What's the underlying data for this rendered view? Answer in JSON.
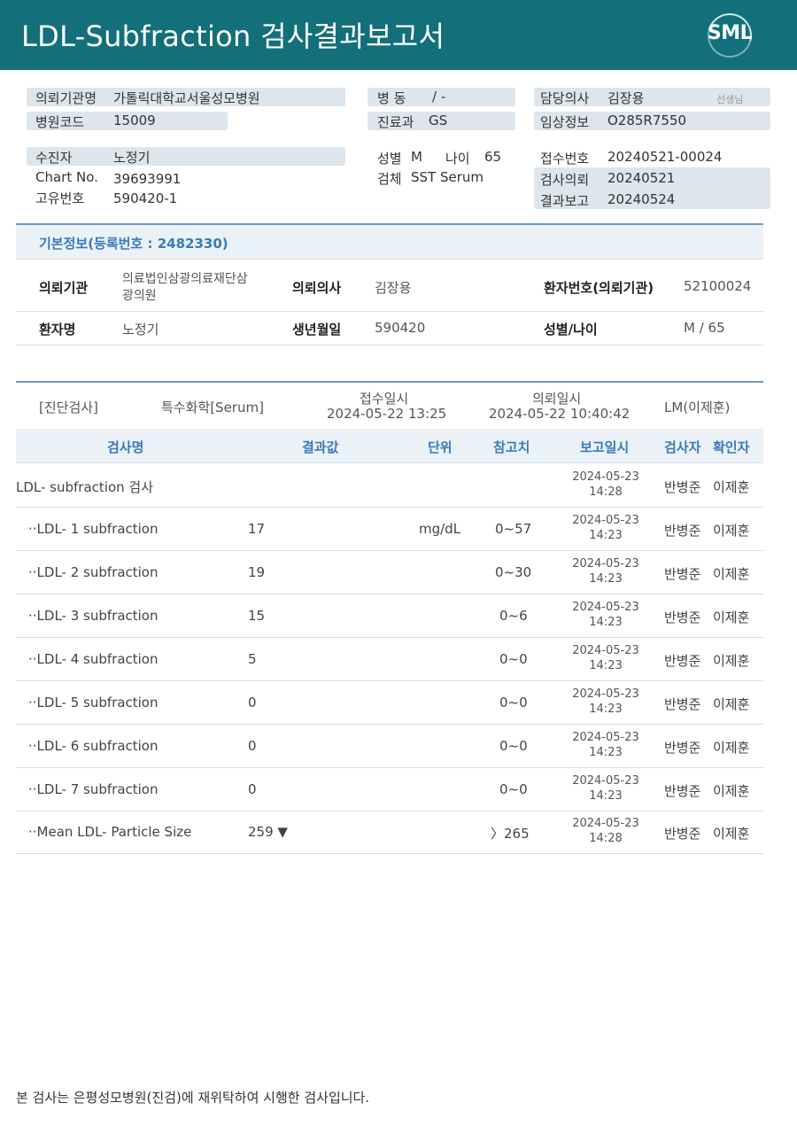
{
  "header": {
    "title": "LDL-Subfraction 검사결과보고서",
    "logo_text": "SML"
  },
  "summary": {
    "req_institution_label": "의뢰기관명",
    "req_institution": "가톨릭대학교서울성모병원",
    "hospital_code_label": "병원코드",
    "hospital_code": "15009",
    "ward_label": "병 동",
    "ward": "/ -",
    "dept_label": "진료과",
    "dept": "GS",
    "doctor_label": "담당의사",
    "doctor": "김장용",
    "doctor_suffix": "선생님",
    "clinical_label": "임상정보",
    "clinical": "O285R7550",
    "patient_label": "수진자",
    "patient": "노정기",
    "chart_label": "Chart No.",
    "chart": "39693991",
    "uid_label": "고유번호",
    "uid": "590420-1",
    "sex_label": "성별",
    "sex": "M",
    "age_label": "나이",
    "age": "65",
    "specimen_label": "검체",
    "specimen": "SST Serum",
    "receipt_label": "접수번호",
    "receipt": "20240521-00024",
    "exam_req_label": "검사의뢰",
    "exam_req": "20240521",
    "result_report_label": "결과보고",
    "result_report": "20240524"
  },
  "basic_info": {
    "heading": "기본정보(등록번호 : 2482330)",
    "inst_label": "의뢰기관",
    "inst_line1": "의료법인삼광의료재단삼",
    "inst_line2": "광의원",
    "req_doctor_label": "의뢰의사",
    "req_doctor": "김장용",
    "patient_no_label": "환자번호(의뢰기관)",
    "patient_no": "52100024",
    "patient_name_label": "환자명",
    "patient_name": "노정기",
    "birth_label": "생년월일",
    "birth": "590420",
    "sexage_label": "성별/나이",
    "sexage": "M / 65"
  },
  "exam_info": {
    "category": "[진단검사]",
    "type": "특수화학[Serum]",
    "receipt_label": "접수일시",
    "receipt_dt": "2024-05-22 13:25",
    "request_label": "의뢰일시",
    "request_dt": "2024-05-22 10:40:42",
    "lab": "LM(이제훈)"
  },
  "columns": {
    "name": "검사명",
    "result": "결과값",
    "unit": "단위",
    "ref": "참고치",
    "report": "보고일시",
    "tester": "검사자",
    "confirmer": "확인자"
  },
  "rows": [
    {
      "name": "LDL- subfraction 검사",
      "result": "",
      "unit": "",
      "ref": "",
      "date": "2024-05-23",
      "time": "14:28",
      "tester": "반병준",
      "confirmer": "이제훈"
    },
    {
      "name": "··LDL- 1 subfraction",
      "result": "17",
      "unit": "mg/dL",
      "ref": "0~57",
      "date": "2024-05-23",
      "time": "14:23",
      "tester": "반병준",
      "confirmer": "이제훈"
    },
    {
      "name": "··LDL- 2 subfraction",
      "result": "19",
      "unit": "",
      "ref": "0~30",
      "date": "2024-05-23",
      "time": "14:23",
      "tester": "반병준",
      "confirmer": "이제훈"
    },
    {
      "name": "··LDL- 3 subfraction",
      "result": "15",
      "unit": "",
      "ref": "0~6",
      "date": "2024-05-23",
      "time": "14:23",
      "tester": "반병준",
      "confirmer": "이제훈"
    },
    {
      "name": "··LDL- 4 subfraction",
      "result": "5",
      "unit": "",
      "ref": "0~0",
      "date": "2024-05-23",
      "time": "14:23",
      "tester": "반병준",
      "confirmer": "이제훈"
    },
    {
      "name": "··LDL- 5 subfraction",
      "result": "0",
      "unit": "",
      "ref": "0~0",
      "date": "2024-05-23",
      "time": "14:23",
      "tester": "반병준",
      "confirmer": "이제훈"
    },
    {
      "name": "··LDL- 6 subfraction",
      "result": "0",
      "unit": "",
      "ref": "0~0",
      "date": "2024-05-23",
      "time": "14:23",
      "tester": "반병준",
      "confirmer": "이제훈"
    },
    {
      "name": "··LDL- 7 subfraction",
      "result": "0",
      "unit": "",
      "ref": "0~0",
      "date": "2024-05-23",
      "time": "14:23",
      "tester": "반병준",
      "confirmer": "이제훈"
    },
    {
      "name": "··Mean LDL- Particle Size",
      "result": "259 ▼",
      "unit": "",
      "ref": "〉265",
      "date": "2024-05-23",
      "time": "14:28",
      "tester": "반병준",
      "confirmer": "이제훈"
    }
  ],
  "footer": "본 검사는 은평성모병원(진검)에 재위탁하여 시행한 검사입니다."
}
